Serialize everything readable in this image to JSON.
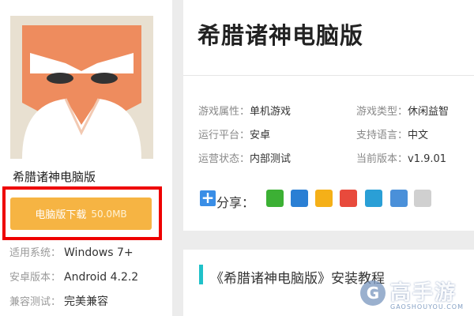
{
  "app": {
    "name": "希腊诸神电脑版",
    "download_label": "电脑版下载",
    "download_size": "50.0MB",
    "meta": [
      {
        "key": "适用系统：",
        "value": "Windows 7+"
      },
      {
        "key": "安卓版本：",
        "value": "Android 4.2.2"
      },
      {
        "key": "兼容测试：",
        "value": "完美兼容"
      }
    ]
  },
  "header": {
    "title": "希腊诸神电脑版"
  },
  "info": {
    "attr_key": "游戏属性：",
    "attr_val": "单机游戏",
    "type_key": "游戏类型：",
    "type_val": "休闲益智",
    "platform_key": "运行平台：",
    "platform_val": "安卓",
    "lang_key": "支持语言：",
    "lang_val": "中文",
    "status_key": "运营状态：",
    "status_val": "内部测试",
    "version_key": "当前版本：",
    "version_val": "v1.9.01"
  },
  "share": {
    "label": "分享：",
    "icons": [
      "wechat-icon",
      "qq-icon",
      "qzone-icon",
      "weibo-icon",
      "tencent-weibo-icon",
      "print-icon",
      "copy-icon"
    ],
    "colors": [
      "#3cb034",
      "#2a7fd4",
      "#f5b018",
      "#e84a3c",
      "#2a9fd6",
      "#4a90d9",
      "#d0d0d0"
    ]
  },
  "tutorial": {
    "title": "《希腊诸神电脑版》安装教程"
  },
  "watermark": {
    "brand": "高手游",
    "sub": "GAOSHOUYOU.COM",
    "logo": "G"
  }
}
